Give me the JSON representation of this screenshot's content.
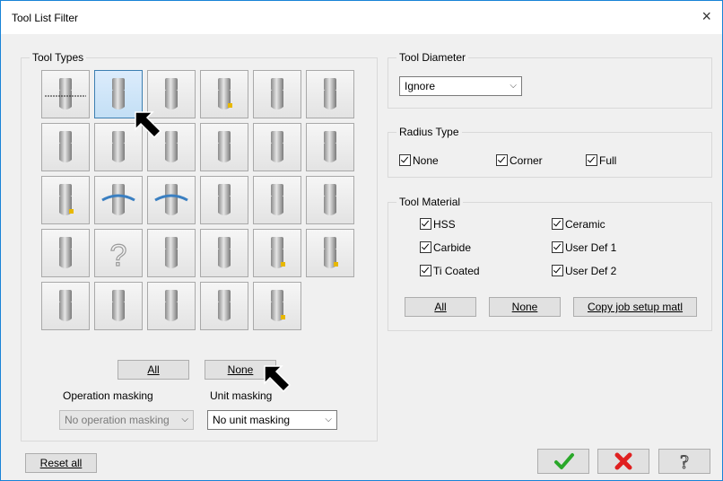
{
  "window": {
    "title": "Tool List Filter",
    "close_glyph": "×"
  },
  "tool_types": {
    "label": "Tool Types",
    "icons": [
      "flat-endmill-icon",
      "flat-endmill-selected-icon",
      "flat-endmill-2-icon",
      "face-mill-icon",
      "chamfer-mill-icon",
      "drill-icon",
      "slot-cutter-icon",
      "spot-drill-icon",
      "dovetail-cutter-icon",
      "lollipop-cutter-icon",
      "bull-endmill-icon",
      "reamer-icon",
      "bore-bar-icon",
      "tap-rh-icon",
      "tap-lh-icon",
      "bull-nose-icon",
      "endmill-icon",
      "thread-mill-icon",
      "center-drill-icon",
      "unknown-tool-icon",
      "engrave-tool-icon",
      "keyseat-cutter-icon",
      "insert-mill-icon",
      "thread-tool-icon",
      "ball-endmill-icon",
      "tapered-mill-icon",
      "barrel-cutter-icon",
      "form-cutter-icon",
      "corner-round-icon"
    ],
    "all_label": "All",
    "none_label": "None"
  },
  "masking": {
    "operation_label": "Operation masking",
    "operation_value": "No operation masking",
    "unit_label": "Unit masking",
    "unit_value": "No unit masking"
  },
  "tool_diameter": {
    "label": "Tool Diameter",
    "value": "Ignore"
  },
  "radius_type": {
    "label": "Radius Type",
    "options": [
      {
        "label": "None",
        "checked": true
      },
      {
        "label": "Corner",
        "checked": true
      },
      {
        "label": "Full",
        "checked": true
      }
    ]
  },
  "tool_material": {
    "label": "Tool Material",
    "options": [
      {
        "label": "HSS",
        "checked": true
      },
      {
        "label": "Carbide",
        "checked": true
      },
      {
        "label": "Ti Coated",
        "checked": true
      },
      {
        "label": "Ceramic",
        "checked": true
      },
      {
        "label": "User Def 1",
        "checked": true
      },
      {
        "label": "User Def 2",
        "checked": true
      }
    ],
    "all_label": "All",
    "none_label": "None",
    "copy_label": "Copy job setup matl"
  },
  "footer": {
    "reset_label": "Reset all",
    "ok_icon": "green-checkmark-icon",
    "cancel_icon": "red-x-icon",
    "help_icon": "question-mark-icon"
  },
  "colors": {
    "accent": "#0078d7",
    "ok": "#2aa82a",
    "cancel": "#e02020"
  }
}
